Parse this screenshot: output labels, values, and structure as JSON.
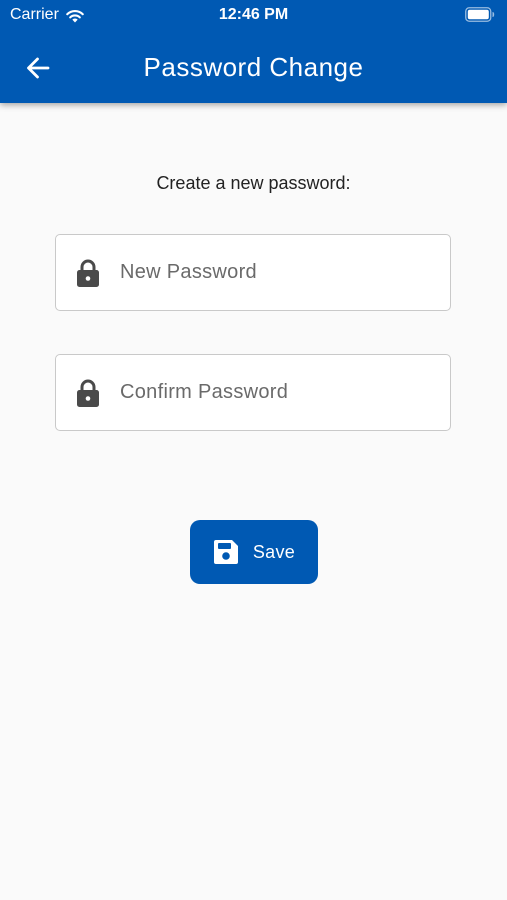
{
  "status_bar": {
    "carrier": "Carrier",
    "time": "12:46 PM"
  },
  "header": {
    "title": "Password Change",
    "back_icon": "arrow-left-icon",
    "background_color": "#0059b3"
  },
  "form": {
    "instruction": "Create a new password:",
    "new_password": {
      "placeholder": "New Password",
      "value": "",
      "icon": "lock-icon"
    },
    "confirm_password": {
      "placeholder": "Confirm Password",
      "value": "",
      "icon": "lock-icon"
    },
    "save_button": {
      "label": "Save",
      "icon": "floppy-disk-icon",
      "color": "#0059b3"
    }
  }
}
